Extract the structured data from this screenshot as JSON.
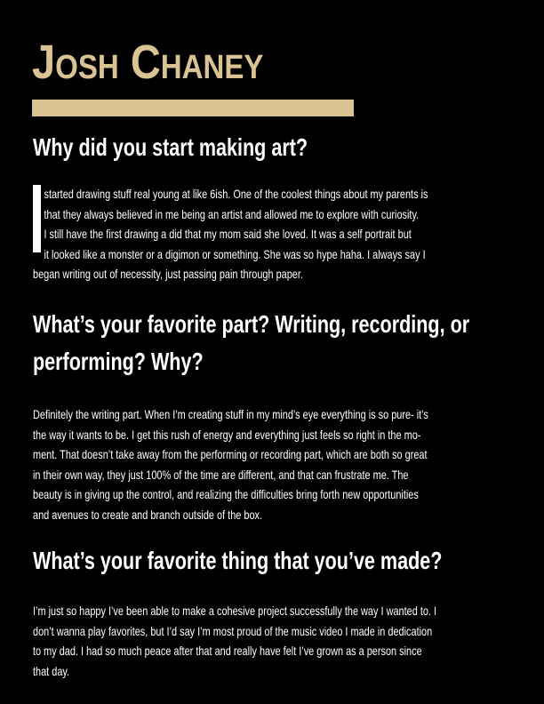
{
  "title": "Josh Chaney",
  "sections": [
    {
      "heading": "Why did you start making art?",
      "dropcap": "I",
      "lines": [
        "started drawing stuff real young at like 6ish. One of the coolest things about my parents is",
        "that they always believed in me being an artist and allowed me to explore with curiosity.",
        "I still have the first drawing a did that my mom said she loved. It was a self portrait but",
        "it looked like a monster or a digimon or something. She was so hype haha. I always say I",
        "began writing out of necessity, just passing pain through paper."
      ]
    },
    {
      "heading_lines": [
        "What’s your favorite part? Writing, recording, or",
        "performing? Why?"
      ],
      "lines": [
        "Definitely the writing part. When I’m creating stuff in my mind’s eye everything is so pure-  it’s",
        "the way it wants to be. I get this rush of energy and everything just feels so right in the mo-",
        "ment. That doesn’t take away from the performing or recording part, which are both so great",
        "in their own way, they just 100% of the time are different, and that can frustrate me. The",
        "beauty is in giving up the control, and realizing the difficulties bring forth new opportunities",
        "and avenues to create and branch outside of the box."
      ]
    },
    {
      "heading": "What’s your favorite thing that you’ve made?",
      "lines": [
        "I’m just so happy I’ve been able to make a cohesive project successfully the way I wanted to. I",
        "don’t wanna play favorites, but I’d say I’m most proud of the music video I made in dedication",
        "to my dad. I had so much peace after that and really have felt I’ve grown as a person since",
        "that day."
      ]
    }
  ],
  "colors": {
    "background": "#000000",
    "accent": "#d9c393",
    "text": "#ffffff"
  }
}
